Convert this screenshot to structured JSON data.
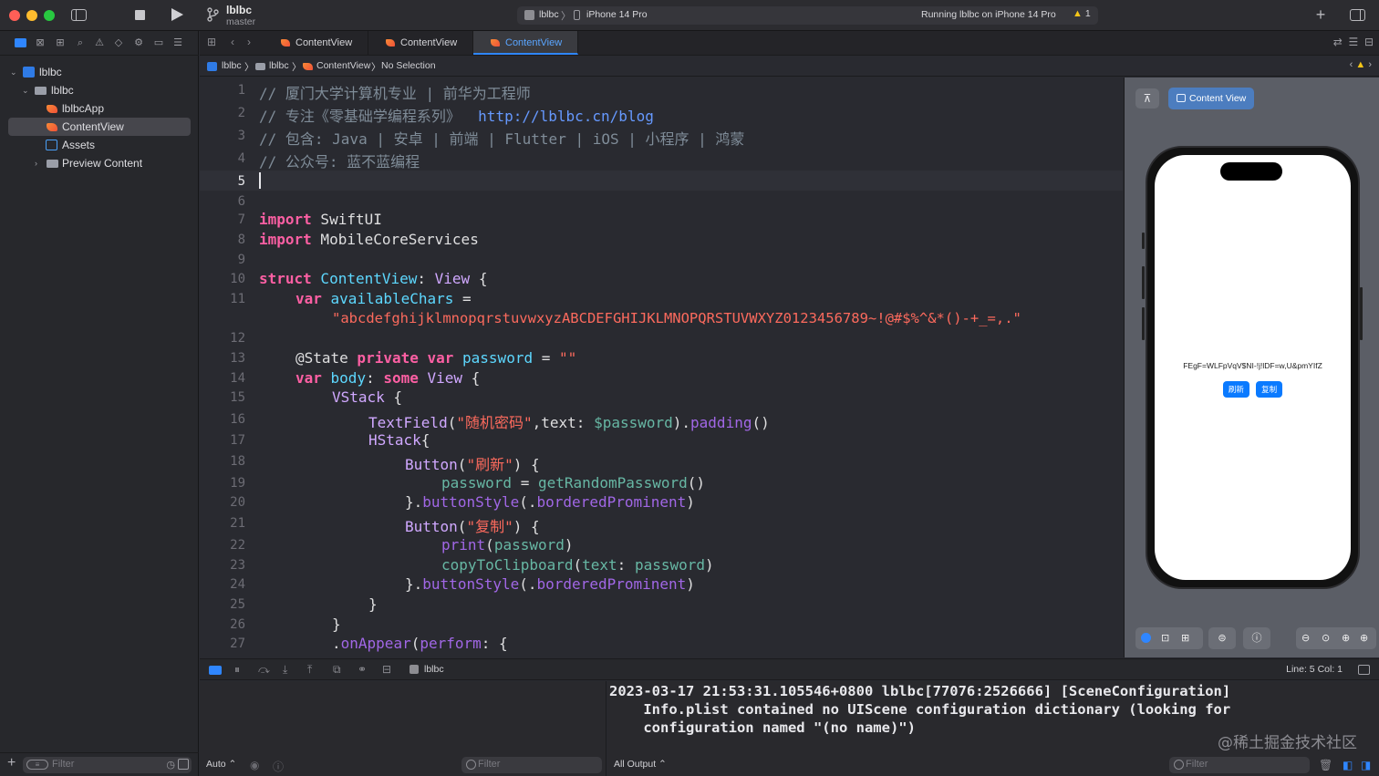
{
  "toolbar": {
    "project_name": "lblbc",
    "branch": "master",
    "scheme_app": "lblbc",
    "scheme_separator": "〉",
    "device": "iPhone 14 Pro",
    "run_status": "Running lblbc on iPhone 14 Pro",
    "warning_count": "1",
    "add_label": "+"
  },
  "navigator": {
    "items": [
      {
        "label": "lblbc",
        "disclosure": "⌄"
      },
      {
        "label": "lblbc",
        "disclosure": "⌄"
      },
      {
        "label": "lblbcApp"
      },
      {
        "label": "ContentView"
      },
      {
        "label": "Assets"
      },
      {
        "label": "Preview Content",
        "disclosure": "›"
      }
    ],
    "filter_placeholder": "Filter",
    "add_label": "+"
  },
  "tabs": [
    {
      "label": "ContentView"
    },
    {
      "label": "ContentView"
    },
    {
      "label": "ContentView"
    }
  ],
  "jumpbar": {
    "project": "lblbc",
    "folder": "lblbc",
    "file": "ContentView",
    "selection": "No Selection",
    "sep": "〉"
  },
  "editor": {
    "current_line": 5,
    "line_numbers": [
      "1",
      "2",
      "3",
      "4",
      "5",
      "6",
      "7",
      "8",
      "9",
      "10",
      "11",
      "",
      "12",
      "13",
      "14",
      "15",
      "16",
      "17",
      "18",
      "19",
      "20",
      "21",
      "22",
      "23",
      "24",
      "25",
      "26",
      "27"
    ]
  },
  "code": {
    "l1": "// 厦门大学计算机专业 | 前华为工程师",
    "l2a": "// 专注《零基础学编程系列》  ",
    "l2b": "http://lblbc.cn/blog",
    "l3": "// 包含: Java | 安卓 | 前端 | Flutter | iOS | 小程序 | 鸿蒙",
    "l4": "// 公众号: 蓝不蓝编程",
    "kw_import": "import",
    "swiftui": " SwiftUI",
    "mcs": " MobileCoreServices",
    "kw_struct": "struct",
    "contentview": " ContentView",
    "colon_view": ": ",
    "view": "View",
    "brace_open": " {",
    "kw_var": "var",
    "available_chars": " availableChars",
    "eq": " =",
    "chars_str": "\"abcdefghijklmnopqrstuvwxyzABCDEFGHIJKLMNOPQRSTUVWXYZ0123456789~!@#$%^&*()-+_=,.\"",
    "state": "@State",
    "kw_private": " private",
    "kw_var2": " var",
    "password": " password",
    "eq_empty_a": " = ",
    "empty_str": "\"\"",
    "body": " body",
    "colon": ": ",
    "kw_some": "some",
    "view2": " View",
    "vstack": "VStack",
    "textfield": "TextField",
    "tf_str": "\"随机密码\"",
    "tf_text": ",text: ",
    "tf_binding": "$password",
    "tf_close": ").",
    "padding": "padding",
    "paren_pair": "()",
    "hstack": "HStack",
    "hs_brace": "{",
    "button": "Button",
    "btn1_str": "\"刷新\"",
    "btn_close": ") {",
    "password_plain": "password",
    "assign": " = ",
    "getrandom": "getRandomPassword",
    "close_paren": "()",
    "brace_close": "}",
    "dot": ".",
    "buttonstyle": "buttonStyle",
    "open_dot": "(.",
    "bordered": "borderedProminent",
    "rparen": ")",
    "btn2_str": "\"复制\"",
    "print": "print",
    "lparen": "(",
    "password_arg": "password",
    "copy_fn": "copyToClipboard",
    "text_label": "text",
    "onappear": "onAppear",
    "perform": "perform",
    "perform_tail": ": {",
    "open_paren_plain": "("
  },
  "preview": {
    "pin_label": "⊼",
    "tab_label": "Content View",
    "password_text": "FEgF=WLFpVqV$NI-!j!lDF=w,U&pmYIfZ",
    "refresh_button": "刷新",
    "copy_button": "复制"
  },
  "debugbar": {
    "target": "lblbc",
    "line_col": "Line: 5  Col: 1"
  },
  "debug": {
    "vars_mode": "Auto ⌃",
    "vars_filter": "Filter",
    "console_lines": "2023-03-17 21:53:31.105546+0800 lblbc[77076:2526666] [SceneConfiguration]\n    Info.plist contained no UIScene configuration dictionary (looking for\n    configuration named \"(no name)\")",
    "output_mode": "All Output ⌃",
    "console_filter": "Filter",
    "watermark": "@稀土掘金技术社区"
  }
}
